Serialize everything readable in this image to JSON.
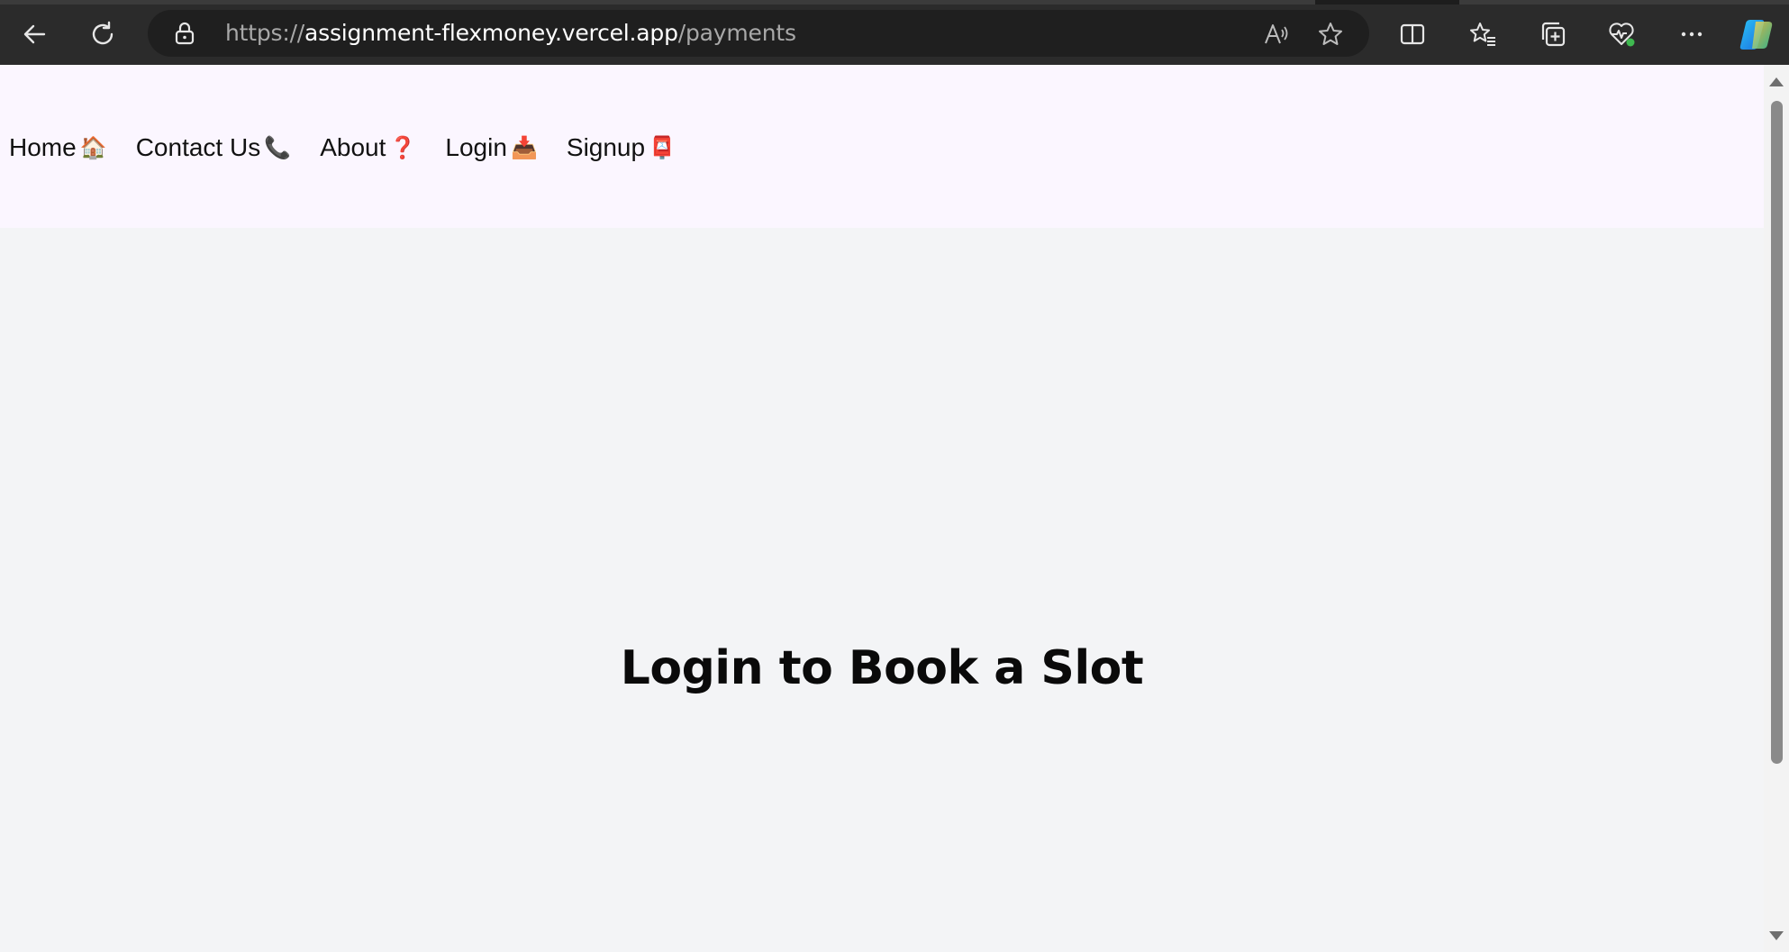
{
  "browser": {
    "url_scheme": "https://",
    "url_host": "assignment-flexmoney.vercel.app",
    "url_path": "/payments",
    "icons": {
      "back": "back-arrow-icon",
      "refresh": "refresh-icon",
      "lock": "lock-icon",
      "read_aloud": "read-aloud-icon",
      "favorite": "star-icon",
      "split_screen": "split-screen-icon",
      "favorites": "favorites-icon",
      "collections": "collections-icon",
      "health": "browser-essentials-icon",
      "more": "more-icon",
      "copilot": "copilot-icon"
    }
  },
  "nav": {
    "items": [
      {
        "label": "Home",
        "emoji": "🏠"
      },
      {
        "label": "Contact Us",
        "emoji": "📞"
      },
      {
        "label": "About",
        "emoji": "❓"
      },
      {
        "label": "Login",
        "emoji": "📥"
      },
      {
        "label": "Signup",
        "emoji": "📮"
      }
    ]
  },
  "main": {
    "headline": "Login to Book a Slot"
  },
  "colors": {
    "navbar_bg": "#fbf6ff",
    "page_bg": "#f3f4f6",
    "browser_chrome": "#2b2b2b"
  }
}
